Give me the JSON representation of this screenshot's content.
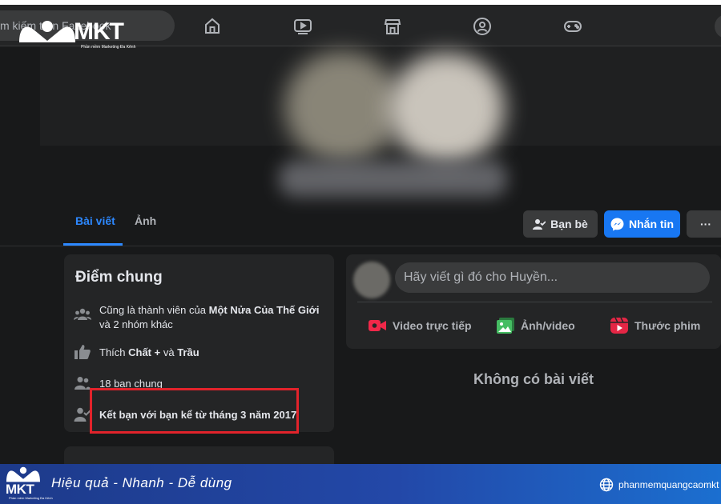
{
  "search": {
    "placeholder_visible": "m kiếm trên Facebook"
  },
  "watermark": {
    "brand": "MKT",
    "tagline": "Phần mềm Marketing Đa Kênh"
  },
  "nav": {
    "icons": [
      "home-icon",
      "video-icon",
      "marketplace-icon",
      "groups-icon",
      "gaming-icon"
    ]
  },
  "profile": {
    "tabs": [
      {
        "label": "Bài viết",
        "active": true
      },
      {
        "label": "Ảnh",
        "active": false
      }
    ],
    "buttons": {
      "friends": "Bạn bè",
      "message": "Nhắn tin",
      "more": "···"
    }
  },
  "intro": {
    "title": "Điểm chung",
    "rows": [
      {
        "icon": "groups-icon",
        "prefix": "Cũng là thành viên của ",
        "bold": "Một Nửa Của Thế Giới",
        "suffix": " và 2 nhóm khác"
      },
      {
        "icon": "like-icon",
        "prefix": "Thích ",
        "bold": "Chất + ",
        "mid": "và ",
        "bold2": "Trầu"
      },
      {
        "icon": "mutual-friends-icon",
        "text": "18 bạn chung"
      },
      {
        "icon": "friend-since-icon",
        "text": "Kết bạn với bạn kể từ tháng 3 năm 2017"
      }
    ]
  },
  "composer": {
    "placeholder": "Hãy viết gì đó cho Huyền...",
    "actions": [
      {
        "label": "Video trực tiếp",
        "icon": "live-video-icon",
        "color": "#f02849"
      },
      {
        "label": "Ảnh/video",
        "icon": "photo-icon",
        "color": "#45bd62"
      },
      {
        "label": "Thước phim",
        "icon": "reels-icon",
        "color": "#e42645"
      }
    ]
  },
  "feed": {
    "empty_text": "Không có bài viết"
  },
  "banner": {
    "slogan": "Hiệu quả - Nhanh  - Dễ dùng",
    "website": "phanmemquangcaomkt"
  },
  "colors": {
    "accent": "#2d88ff",
    "primary_button": "#1877f2",
    "highlight_box": "#e2232b",
    "background": "#18191a",
    "card": "#242526"
  }
}
